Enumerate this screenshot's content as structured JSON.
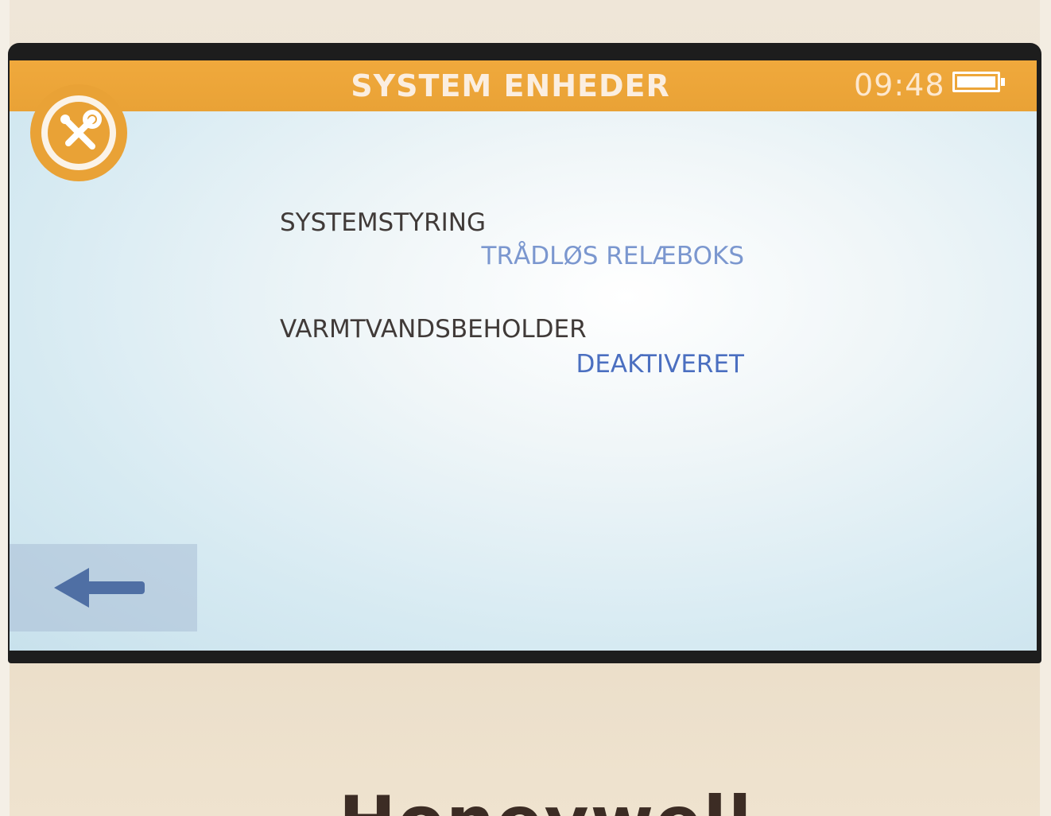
{
  "header": {
    "title": "SYSTEM ENHEDER",
    "clock": "09:48",
    "battery_icon": "battery-full-icon"
  },
  "menu_icon": "tools-icon",
  "settings": [
    {
      "label": "SYSTEMSTYRING",
      "value": "TRÅDLØS RELÆBOKS"
    },
    {
      "label": "VARMTVANDSBEHOLDER",
      "value": "DEAKTIVERET"
    }
  ],
  "back_button": {
    "icon": "back-arrow-icon"
  },
  "brand": {
    "name": "Honeywell"
  },
  "colors": {
    "header": "#e9a236",
    "label_text": "#403a38",
    "value_text": "#4b6fc0",
    "back_arrow": "#4f6fa4"
  }
}
